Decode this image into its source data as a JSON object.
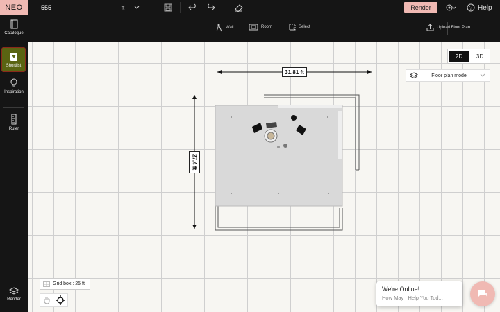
{
  "app": {
    "brand": "NEO",
    "project_name": "555"
  },
  "unit_select": {
    "value": "ft"
  },
  "topbar": {
    "render_label": "Render",
    "help_label": "Help"
  },
  "toolbar": {
    "wall_label": "Wall",
    "room_label": "Room",
    "select_label": "Select",
    "upload_label": "Upload Floor Plan"
  },
  "sidebar": {
    "items": [
      {
        "label": "Catalogue"
      },
      {
        "label": "Shortlist"
      },
      {
        "label": "Inspiration"
      },
      {
        "label": "Ruler"
      },
      {
        "label": "Render"
      }
    ]
  },
  "view": {
    "two_d": "2D",
    "three_d": "3D",
    "active": "2D"
  },
  "mode_select": {
    "value": "Floor plan mode"
  },
  "dimensions": {
    "width": "31.81 ft",
    "height": "27.4 ft"
  },
  "gridbox": {
    "label": "Grid box : 25 ft"
  },
  "chat": {
    "title": "We're Online!",
    "subtitle": "How May I Help You Tod..."
  },
  "colors": {
    "accent": "#f0b9b3",
    "dark": "#151515",
    "shortlist_active": "#5a6412"
  },
  "icons": {
    "save": "save-icon",
    "undo": "undo-icon",
    "redo": "redo-icon",
    "eraser": "eraser-icon",
    "settings": "gear-icon",
    "help": "help-icon",
    "chat": "chat-icon"
  }
}
